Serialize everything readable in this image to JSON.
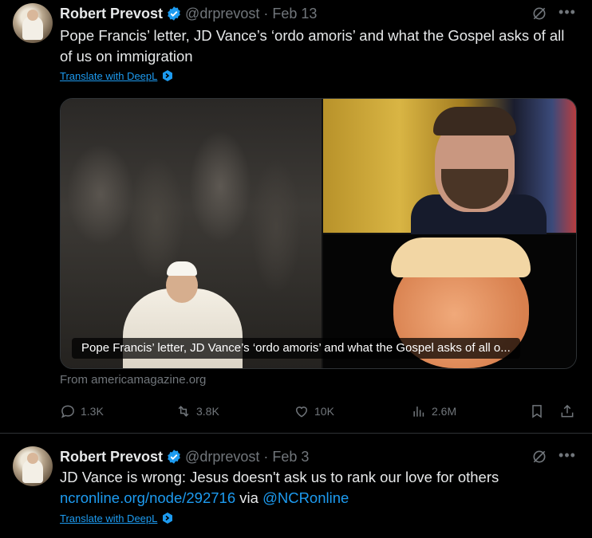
{
  "tweets": [
    {
      "author": "Robert Prevost",
      "handle": "@drprevost",
      "separator": "·",
      "date": "Feb 13",
      "text": "Pope Francis’ letter, JD Vance’s ‘ordo amoris’ and what the Gospel asks of all of us on immigration",
      "translate_label": "Translate with DeepL",
      "card": {
        "caption": "Pope Francis’ letter, JD Vance’s ‘ordo amoris’ and what the Gospel asks of all o...",
        "source": "From americamagazine.org"
      },
      "stats": {
        "replies": "1.3K",
        "reposts": "3.8K",
        "likes": "10K",
        "views": "2.6M"
      }
    },
    {
      "author": "Robert Prevost",
      "handle": "@drprevost",
      "separator": "·",
      "date": "Feb 3",
      "text": "JD Vance is wrong: Jesus doesn't ask us to rank our love for others",
      "link": "ncronline.org/node/292716",
      "via": "via",
      "mention": "@NCRonline",
      "translate_label": "Translate with DeepL"
    }
  ],
  "icons": {
    "verified": "verified-badge-icon",
    "grok": "grok-icon",
    "more": "more-icon",
    "deepl": "deepl-icon",
    "reply": "reply-icon",
    "repost": "repost-icon",
    "like": "like-icon",
    "views": "views-icon",
    "bookmark": "bookmark-icon",
    "share": "share-icon"
  },
  "colors": {
    "background": "#000000",
    "text": "#e7e9ea",
    "muted": "#71767b",
    "accent": "#1d9bf0",
    "divider": "#2f3336"
  }
}
